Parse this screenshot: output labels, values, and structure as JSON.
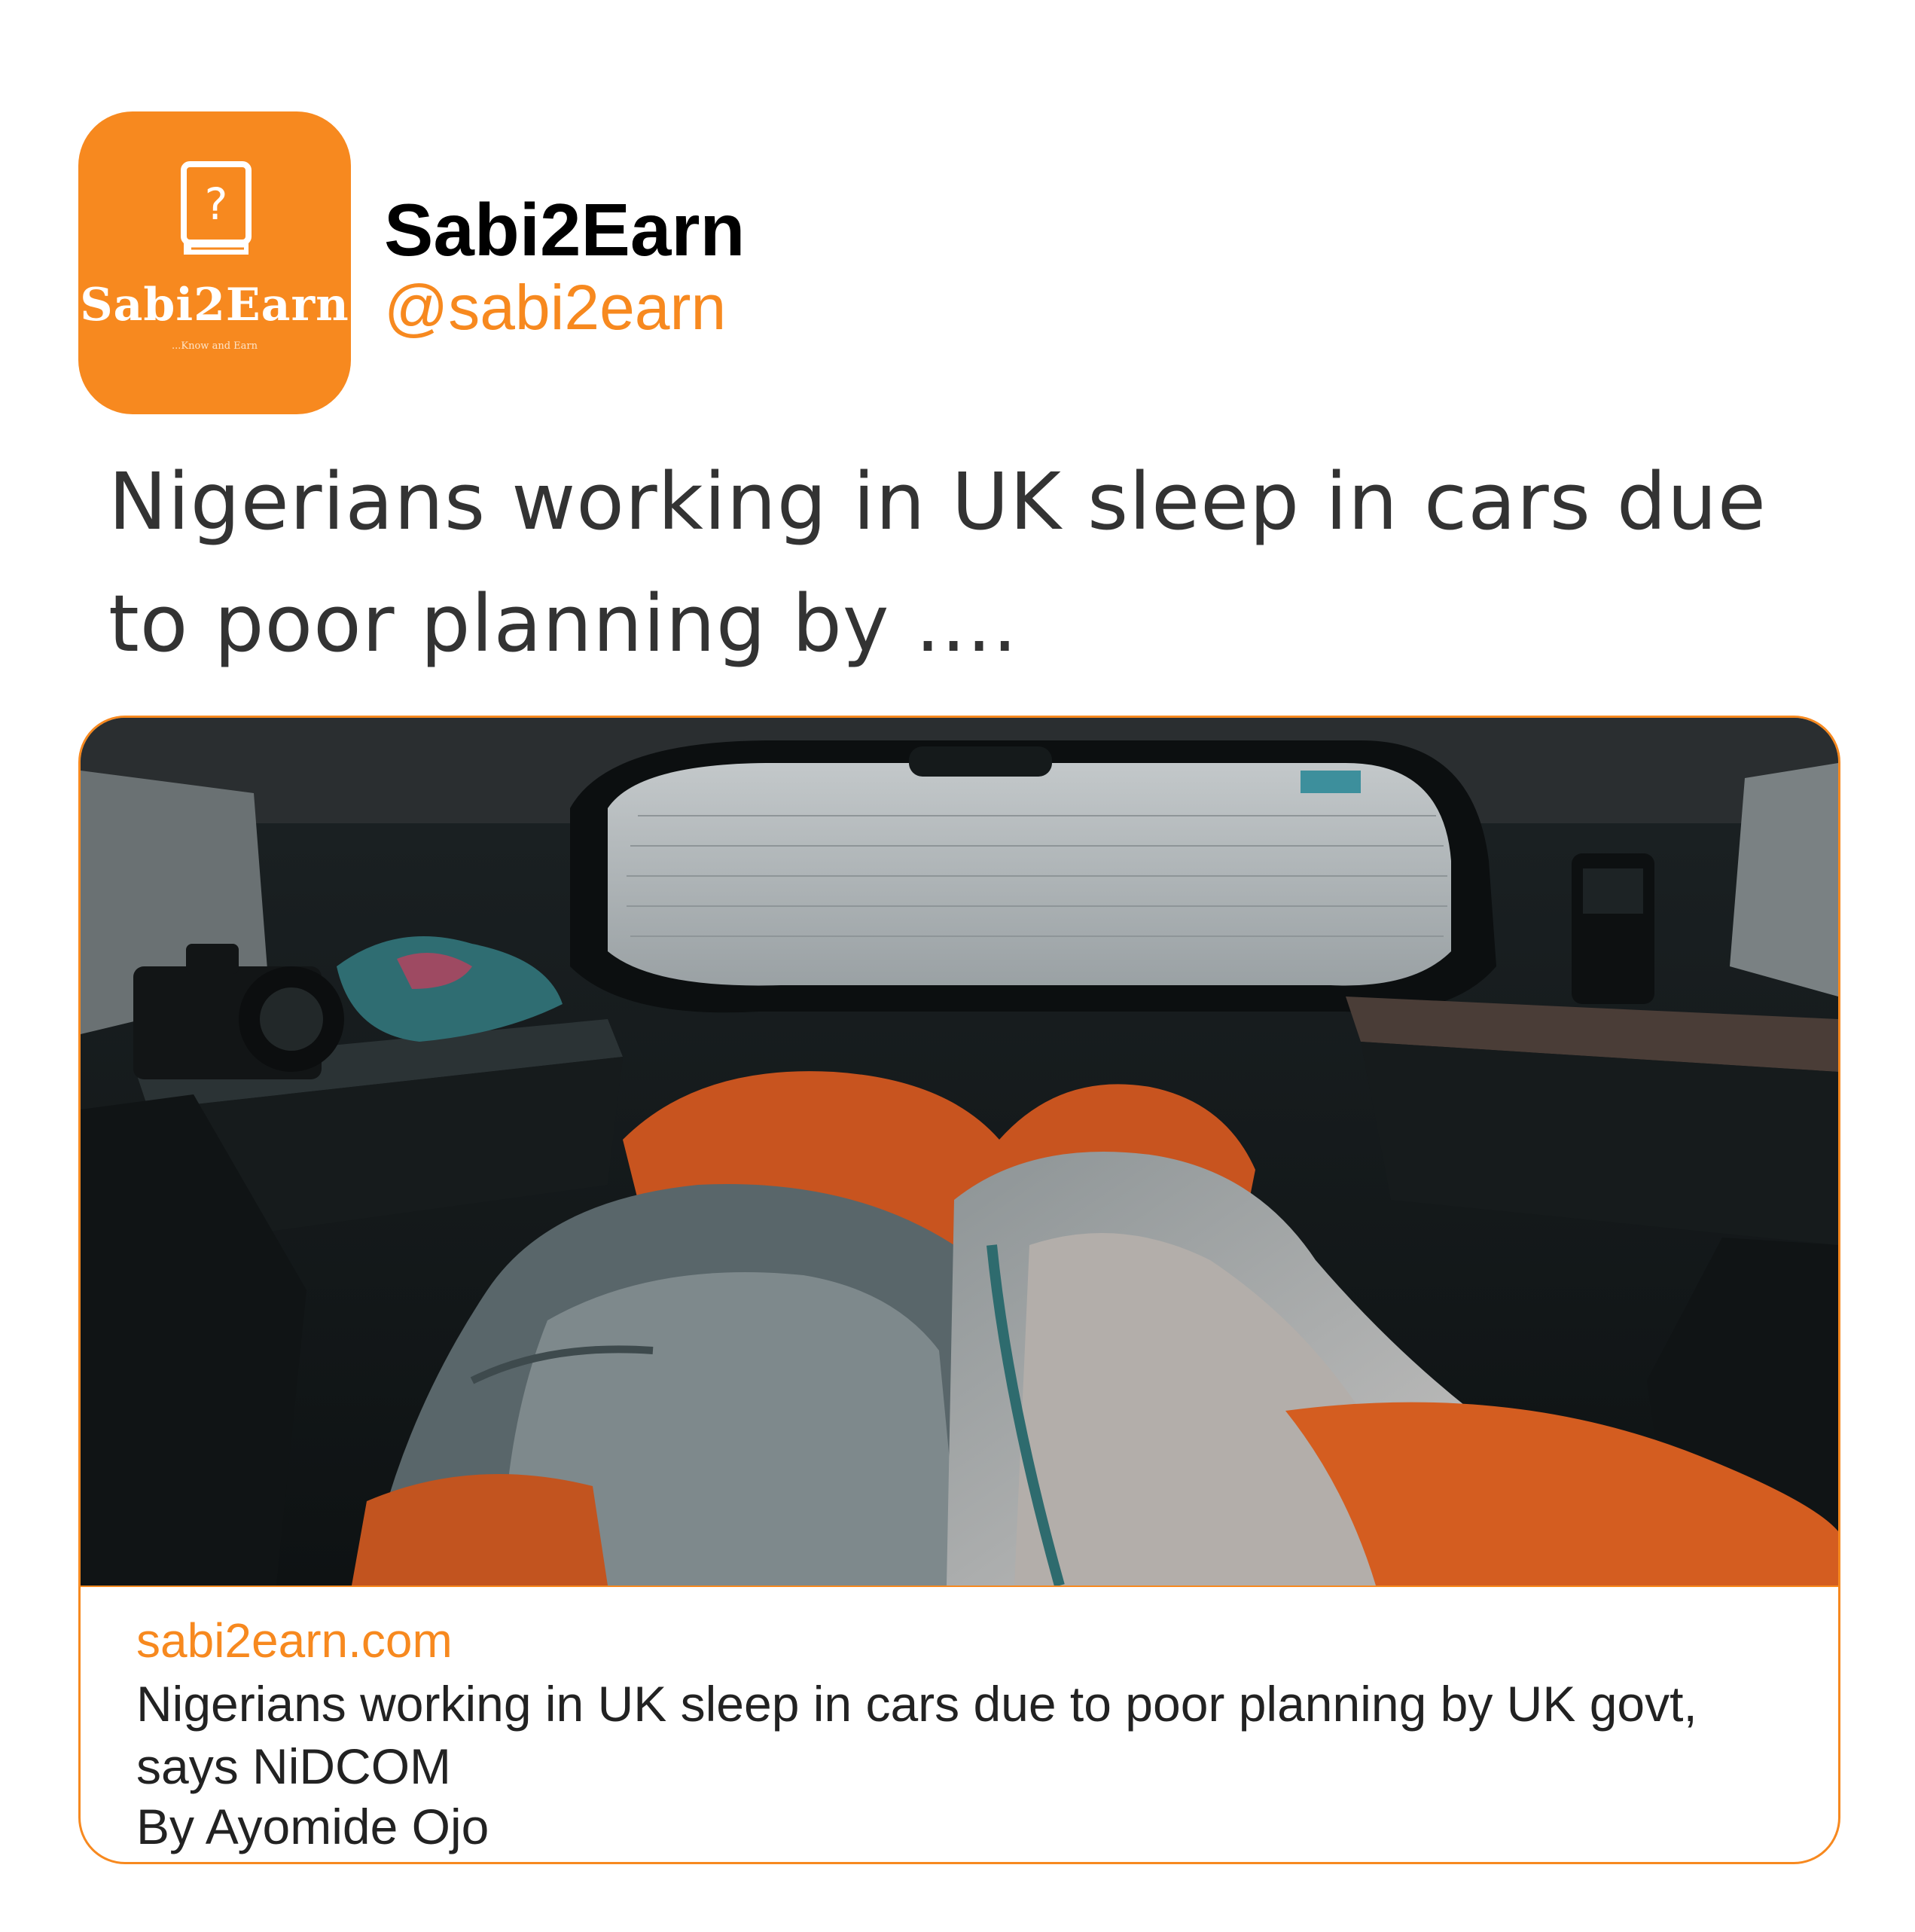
{
  "profile": {
    "display_name": "Sabi2Earn",
    "handle": "@sabi2earn",
    "avatar": {
      "brand_text": "Sabi2Earn",
      "tagline": "...Know and Earn",
      "icon": "question-book-icon",
      "background_color": "#f7891f"
    }
  },
  "tweet": {
    "text": "Nigerians working in UK sleep in cars due to poor planning by ...."
  },
  "link_card": {
    "image": "sleeping-bags-in-car-trunk-photo",
    "domain": "sabi2earn.com",
    "title": "Nigerians working in UK sleep in cars due to poor planning by UK govt, says NiDCOM",
    "byline": "By Ayomide Ojo"
  },
  "colors": {
    "accent": "#f7891f",
    "text_dark": "#222222",
    "text_tweet": "#333333"
  }
}
